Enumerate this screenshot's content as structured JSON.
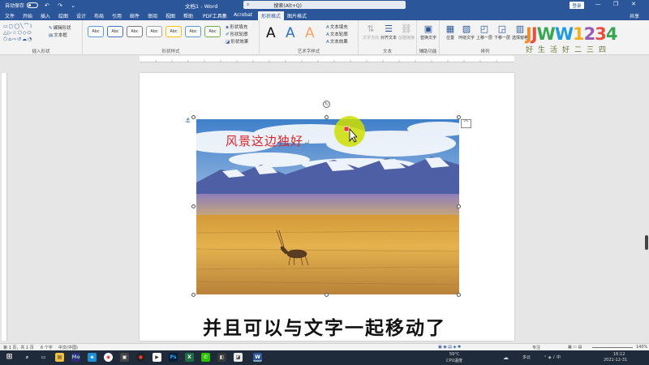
{
  "window": {
    "autosave_label": "自动保存",
    "autosave_state": "关",
    "quick_access": "↶ ↷ ⌄",
    "doc_title": "文档1 - Word",
    "search_placeholder": "搜索(Alt+Q)",
    "signin_label": "登录",
    "controls": {
      "min": "—",
      "restore": "❐",
      "close": "✕"
    }
  },
  "tabs": [
    {
      "label": "文件"
    },
    {
      "label": "开始"
    },
    {
      "label": "插入"
    },
    {
      "label": "绘图"
    },
    {
      "label": "设计"
    },
    {
      "label": "布局"
    },
    {
      "label": "引用"
    },
    {
      "label": "邮件"
    },
    {
      "label": "审阅"
    },
    {
      "label": "视图"
    },
    {
      "label": "帮助"
    },
    {
      "label": "PDF工具集"
    },
    {
      "label": "Acrobat"
    },
    {
      "label": "形状格式"
    },
    {
      "label": "图片格式"
    }
  ],
  "share_label": "共享",
  "ribbon": {
    "insert_shapes": {
      "label": "插入形状",
      "edit_shape": "编辑形状",
      "text_box": "文本框"
    },
    "shape_styles": {
      "label": "形状样式",
      "presets": [
        "Abc",
        "Abc",
        "Abc",
        "Abc",
        "Abc",
        "Abc",
        "Abc"
      ],
      "fill": "形状填充",
      "outline": "形状轮廓",
      "effects": "形状效果"
    },
    "wordart_styles": {
      "label": "艺术字样式",
      "samples": [
        "A",
        "A",
        "A"
      ],
      "text_fill": "文本填充",
      "text_outline": "文本轮廓",
      "text_effects": "文本效果"
    },
    "text": {
      "label": "文本",
      "direction": "文字方向",
      "align": "对齐文本",
      "link": "创建链接"
    },
    "accessibility": {
      "label": "辅助功能",
      "alt_text": "替换文字"
    },
    "arrange": {
      "label": "排列",
      "position": "位置",
      "wrap": "环绕文字",
      "forward": "上移一层",
      "backward": "下移一层",
      "pane": "选择窗格"
    }
  },
  "watermark": {
    "brand": [
      "J",
      "J",
      "W",
      "W",
      "1",
      "2",
      "3",
      "4"
    ],
    "slogan": "好生活好二三四"
  },
  "document": {
    "image_title": "风景这边独好",
    "return_mark": "↵"
  },
  "caption": "并且可以与文字一起移动了",
  "statusbar": {
    "page": "第 1 页，共 1 页",
    "words": "6 个字",
    "language": "中文(中国)",
    "focus": "专注",
    "zoom": "140%"
  },
  "taskbar": {
    "temperature": "59°C",
    "cpu": "CPU温度",
    "weather": "多云",
    "time": "16:12",
    "date": "2021-12-31",
    "search_icon": "magnifier-icon"
  },
  "colors": {
    "word_blue": "#2b579a",
    "title_red": "#d9232a",
    "halo_yellow": "#cede00"
  }
}
